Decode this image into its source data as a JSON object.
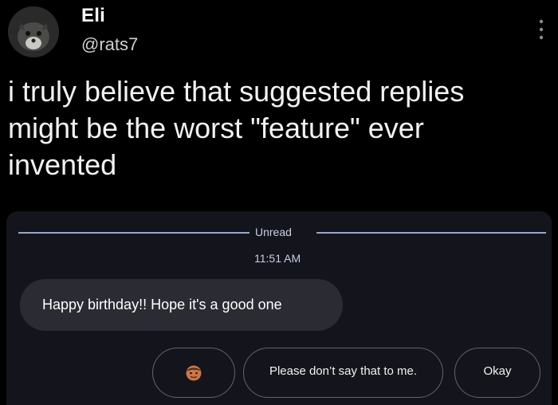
{
  "tweet": {
    "author_name": "Eli",
    "author_handle": "@rats7",
    "text_lines": [
      "i truly believe that suggested replies",
      "might be the worst \"feature\" ever",
      "invented"
    ]
  },
  "screenshot": {
    "unread_label": "Unread",
    "time": "11:51 AM",
    "message": "Happy birthday!! Hope it's a good one",
    "suggested_replies": [
      {
        "icon": "man-emoji-icon"
      },
      {
        "label": "Please don’t say that to me."
      },
      {
        "label": "Okay"
      }
    ]
  },
  "colors": {
    "background": "#000000",
    "card_background": "#14151c",
    "bubble_background": "#2a2b33",
    "chip_border": "#5f6472"
  }
}
